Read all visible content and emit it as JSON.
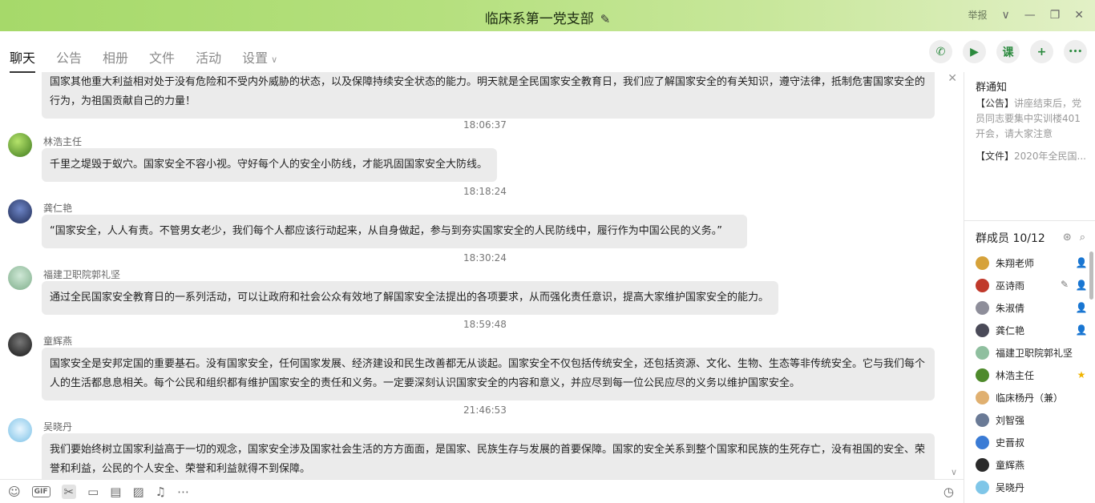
{
  "window": {
    "title": "临床系第一党支部",
    "report_label": "举报"
  },
  "tabs": [
    {
      "label": "聊天"
    },
    {
      "label": "公告"
    },
    {
      "label": "相册"
    },
    {
      "label": "文件"
    },
    {
      "label": "活动"
    },
    {
      "label": "设置"
    }
  ],
  "tools": {
    "call": "✆",
    "video": "▶",
    "lesson": "课",
    "add": "+",
    "more": "•••"
  },
  "messages": [
    {
      "kind": "bubble",
      "text1": "国家其他重大利益相对处于没有危险和不受内外威胁的状态，以及保障持续安全状态的能力。明天就是全民国家安全教育日，我们应了解国家安全的有关知识，遵守法律，抵制危害国家安全的",
      "text2": "行为，为祖国贡献自己的力量！"
    },
    {
      "kind": "time",
      "text": "18:06:37"
    },
    {
      "kind": "msg",
      "sender": "林浩主任",
      "text": "千里之堤毁于蚁穴。国家安全不容小视。守好每个人的安全小防线，才能巩固国家安全大防线。"
    },
    {
      "kind": "time",
      "text": "18:18:24"
    },
    {
      "kind": "msg",
      "sender": "龚仁艳",
      "text": "“国家安全，人人有责。不管男女老少，我们每个人都应该行动起来，从自身做起，参与到夯实国家安全的人民防线中，履行作为中国公民的义务。”"
    },
    {
      "kind": "time",
      "text": "18:30:24"
    },
    {
      "kind": "msg",
      "sender": "福建卫职院郭礼坚",
      "text": "通过全民国家安全教育日的一系列活动，可以让政府和社会公众有效地了解国家安全法提出的各项要求，从而强化责任意识，提高大家维护国家安全的能力。"
    },
    {
      "kind": "time",
      "text": "18:59:48"
    },
    {
      "kind": "msg",
      "sender": "童辉燕",
      "text1": "国家安全是安邦定国的重要基石。没有国家安全，任何国家发展、经济建设和民生改善都无从谈起。国家安全不仅包括传统安全，还包括资源、文化、生物、生态等非传统安全。它与我们每个",
      "text2": "人的生活都息息相关。每个公民和组织都有维护国家安全的责任和义务。一定要深刻认识国家安全的内容和意义，并应尽到每一位公民应尽的义务以维护国家安全。"
    },
    {
      "kind": "time",
      "text": "21:46:53"
    },
    {
      "kind": "msg",
      "sender": "吴晓丹",
      "text1": "我们要始终树立国家利益高于一切的观念，国家安全涉及国家社会生活的方方面面，是国家、民族生存与发展的首要保障。国家的安全关系到整个国家和民族的生死存亡，没有祖国的安全、荣",
      "text2": "誉和利益，公民的个人安全、荣誉和利益就得不到保障。"
    }
  ],
  "notice": {
    "title": "群通知",
    "announcement_tag": "【公告】",
    "announcement_text": "讲座结束后，党员同志要集中实训楼401开会，请大家注意",
    "file_tag": "【文件】",
    "file_text": "2020年全民国..."
  },
  "members": {
    "title": "群成员 10/12",
    "list": [
      {
        "name": "朱翔老师",
        "color": "#d6a23a",
        "badge": "admin"
      },
      {
        "name": "巫诗雨",
        "color": "#c0392b",
        "badge": "admin"
      },
      {
        "name": "朱淑倩",
        "color": "#8e8e9a",
        "badge": "admin"
      },
      {
        "name": "龚仁艳",
        "color": "#4a4a58",
        "badge": "admin"
      },
      {
        "name": "福建卫职院郭礼坚",
        "color": "#8fbf9f",
        "badge": ""
      },
      {
        "name": "林浩主任",
        "color": "#4e8a2b",
        "badge": "owner"
      },
      {
        "name": "临床杨丹（兼）",
        "color": "#e0b070",
        "badge": ""
      },
      {
        "name": "刘智强",
        "color": "#6a7a96",
        "badge": ""
      },
      {
        "name": "史晋叔",
        "color": "#3a7bd5",
        "badge": ""
      },
      {
        "name": "童辉燕",
        "color": "#2a2a2a",
        "badge": ""
      },
      {
        "name": "吴晓丹",
        "color": "#7fc6e8",
        "badge": ""
      }
    ]
  },
  "icons": {
    "emoji": "☺",
    "gif": "GIF",
    "scissors": "✂",
    "folder": "▭",
    "doc": "▤",
    "image": "▨",
    "bell": "♫",
    "more": "⋯",
    "history": "◷",
    "close": "✕",
    "scroll_down": "∨",
    "pencil": "✎",
    "chevron": "∨",
    "minimize": "—",
    "restore": "❐",
    "close_win": "✕"
  }
}
